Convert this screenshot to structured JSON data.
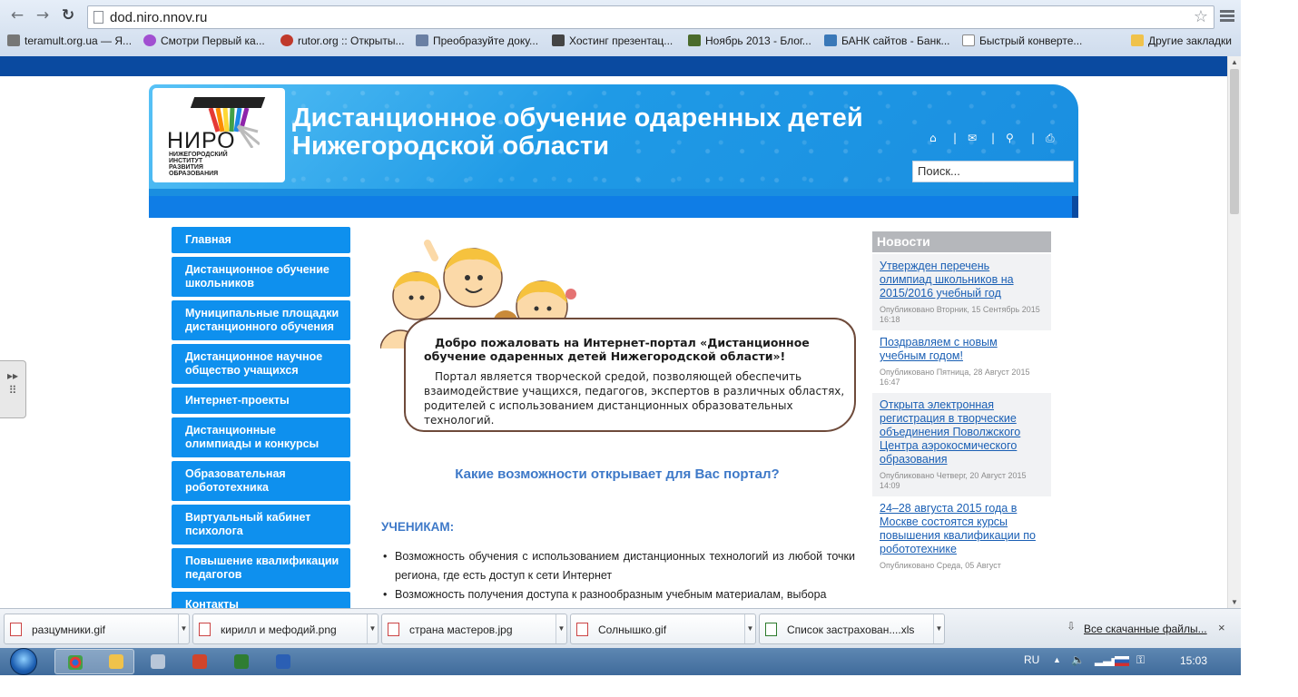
{
  "browser": {
    "url": "dod.niro.nnov.ru",
    "back_icon": "arrow-left-icon",
    "forward_icon": "arrow-right-icon",
    "reload_icon": "reload-icon",
    "bookmarks": [
      {
        "label": "teramult.org.ua — Я..."
      },
      {
        "label": "Смотри Первый ка..."
      },
      {
        "label": "rutor.org :: Открыты..."
      },
      {
        "label": "Преобразуйте доку..."
      },
      {
        "label": "Хостинг презентац..."
      },
      {
        "label": "Ноябрь 2013 - Блог..."
      },
      {
        "label": "БАНК сайтов - Банк..."
      },
      {
        "label": "Быстрый конверте..."
      }
    ],
    "other_bookmarks": "Другие закладки"
  },
  "header": {
    "logo_name": "НИРО",
    "logo_sub": "НИЖЕГОРОДСКИЙ ИНСТИТУТ РАЗВИТИЯ ОБРАЗОВАНИЯ",
    "title_line1": "Дистанционное обучение одаренных детей",
    "title_line2": "Нижегородской области",
    "search_placeholder": "Поиск..."
  },
  "menu": [
    {
      "label": "Главная"
    },
    {
      "label": "Дистанционное обучение школьников"
    },
    {
      "label": "Муниципальные площадки дистанционного обучения"
    },
    {
      "label": "Дистанционное научное общество учащихся"
    },
    {
      "label": "Интернет-проекты"
    },
    {
      "label": "Дистанционные олимпиады и конкурсы"
    },
    {
      "label": "Образовательная робототехника"
    },
    {
      "label": "Виртуальный кабинет психолога"
    },
    {
      "label": "Повышение квалификации педагогов"
    },
    {
      "label": "Контакты"
    }
  ],
  "welcome": {
    "title": "Добро пожаловать на Интернет-портал «Дистанционное обучение одаренных детей Нижегородской области»!",
    "text": "Портал является творческой средой, позволяющей обеспечить взаимодействие учащихся, педагогов, экспертов в различных областях, родителей с использованием дистанционных образовательных технологий."
  },
  "main": {
    "question": "Какие возможности открывает для Вас портал?",
    "students_heading": "УЧЕНИКАМ:",
    "features": [
      "Возможность обучения с использованием дистанционных технологий из любой точки региона, где есть доступ к сети Интернет",
      "Возможность получения доступа к разнообразным учебным материалам, выбора"
    ]
  },
  "news": {
    "heading": "Новости",
    "items": [
      {
        "title": "Утвержден перечень олимпиад школьников на 2015/2016 учебный год",
        "meta": "Опубликовано Вторник, 15 Сентябрь 2015 16:18"
      },
      {
        "title": "Поздравляем с новым учебным годом!",
        "meta": "Опубликовано Пятница, 28 Август 2015 16:47"
      },
      {
        "title": "Открыта электронная регистрация в творческие объединения Поволжского Центра аэрокосмического образования",
        "meta": "Опубликовано Четверг, 20 Август 2015 14:09"
      },
      {
        "title": "24–28 августа 2015 года в Москве состоятся курсы повышения квалификации по робототехнике",
        "meta": "Опубликовано Среда, 05 Август"
      }
    ]
  },
  "downloads": {
    "items": [
      {
        "name": "разцумники.gif"
      },
      {
        "name": "кирилл и мефодий.png"
      },
      {
        "name": "страна мастеров.jpg"
      },
      {
        "name": "Солнышко.gif"
      },
      {
        "name": "Список застрахован....xls"
      }
    ],
    "all_label": "Все скачанные файлы...",
    "close": "×"
  },
  "taskbar": {
    "lang": "RU",
    "time": "15:03"
  }
}
